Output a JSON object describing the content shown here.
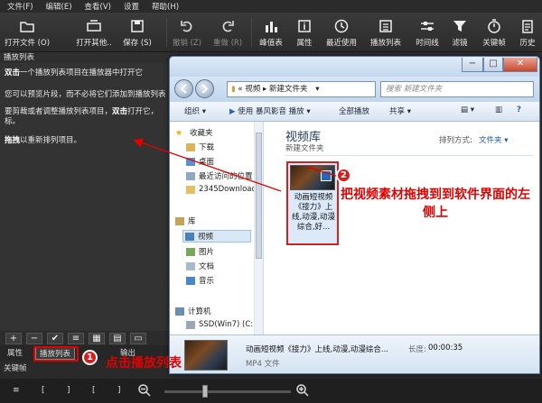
{
  "menu": [
    "文件(F)",
    "编辑(E)",
    "查看(V)",
    "设置",
    "帮助(H)"
  ],
  "toolbar": [
    {
      "label": "打开文件 (O)",
      "icon": "folder-icon",
      "enabled": true
    },
    {
      "label": "打开其他..",
      "icon": "open-other-icon",
      "enabled": true
    },
    {
      "label": "保存 (S)",
      "icon": "save-icon",
      "enabled": true
    },
    {
      "label": "撤销 (Z)",
      "icon": "undo-icon",
      "enabled": false
    },
    {
      "label": "重做 (R)",
      "icon": "redo-icon",
      "enabled": false
    },
    {
      "label": "峰值表",
      "icon": "peak-meter-icon",
      "enabled": true
    },
    {
      "label": "属性",
      "icon": "properties-icon",
      "enabled": true
    },
    {
      "label": "最近使用",
      "icon": "recent-clock-icon",
      "enabled": true
    },
    {
      "label": "播放列表",
      "icon": "playlist-icon",
      "enabled": true
    },
    {
      "label": "时间线",
      "icon": "timeline-icon",
      "enabled": true
    },
    {
      "label": "滤镜",
      "icon": "filter-icon",
      "enabled": true
    },
    {
      "label": "关键帧",
      "icon": "keyframe-stopwatch-icon",
      "enabled": true
    },
    {
      "label": "历史",
      "icon": "history-icon",
      "enabled": true
    }
  ],
  "playlist": {
    "title": "播放列表",
    "line1_bold": "双击",
    "line1_rest": "一个播放列表项目在播放器中打开它",
    "line2": "您可以预览片段，而不必将它们添加到播放列表",
    "line3a": "要剪裁或者调整播放列表项目，",
    "line3b_bold": "双击",
    "line3c": "打开它，",
    "line4": "标。",
    "line5_bold": "拖拽",
    "line5_rest": "以重新排列项目。"
  },
  "playlist_toolbar": [
    "+",
    "−",
    "✔",
    "≡",
    "▦",
    "▤",
    "▭"
  ],
  "tabs": {
    "properties": "属性",
    "playlist": "播放列表",
    "other": "输出"
  },
  "keyframes_label": "关键帧",
  "keyframes_bar": [
    "≡",
    "[",
    "]",
    "[",
    "]"
  ],
  "explorer": {
    "address": [
      "视频",
      "新建文件夹"
    ],
    "search_placeholder": "搜索 新建文件夹",
    "commands": {
      "organize": "组织",
      "open_with": "使用 暴风影音 播放",
      "play_all": "全部播放",
      "share": "共享"
    },
    "nav": {
      "favorites": "收藏夹",
      "downloads": "下载",
      "desktop": "桌面",
      "recent": "最近访问的位置",
      "folder": "2345Download:",
      "library": "库",
      "videos": "视频",
      "pictures": "图片",
      "documents": "文档",
      "music": "音乐",
      "computer": "计算机",
      "drive_c": "SSD(Win7) (C:)"
    },
    "library_title": "视频库",
    "library_sub": "新建文件夹",
    "sort_label": "排列方式:",
    "sort_value": "文件夹",
    "file_name": "动画短视频《接力》上线,动漫,动漫综合,好...",
    "details": {
      "name": "动画短视频《接力》上线,动漫,动漫综合...",
      "length_label": "长度:",
      "length_value": "00:00:35",
      "type": "MP4 文件"
    }
  },
  "annotations": {
    "badge1": "1",
    "badge2": "2",
    "text1": "点击播放列表",
    "text2": "把视频素材拖拽到到软件界面的左侧上"
  },
  "colors": {
    "annotation_red": "#e00000",
    "app_dark": "#333333",
    "explorer_blue": "#c9dcef"
  }
}
